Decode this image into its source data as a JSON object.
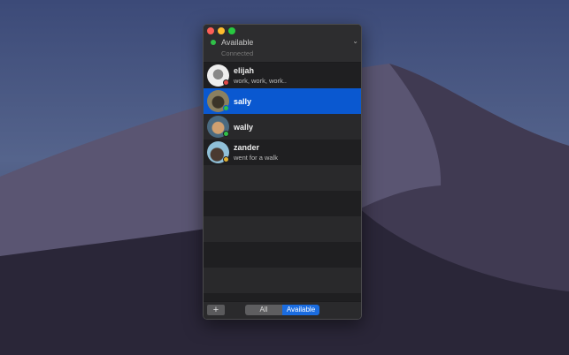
{
  "status": {
    "label": "Available",
    "sub": "Connected",
    "color": "#30c048"
  },
  "contacts": [
    {
      "name": "elijah",
      "message": "work, work, work..",
      "status_color": "#e04848",
      "avatar_color": "#d8d8d8"
    },
    {
      "name": "sally",
      "message": "",
      "status_color": "#30c048",
      "avatar_color": "#6a6450",
      "selected": true
    },
    {
      "name": "wally",
      "message": "",
      "status_color": "#30c048",
      "avatar_color": "#b08858"
    },
    {
      "name": "zander",
      "message": "went for a walk",
      "status_color": "#e0b030",
      "avatar_color": "#7aa8c0"
    }
  ],
  "footer": {
    "add_label": "+",
    "filters": [
      "All",
      "Available"
    ],
    "active_filter": "Available"
  },
  "colors": {
    "accent": "#0a58d0"
  }
}
